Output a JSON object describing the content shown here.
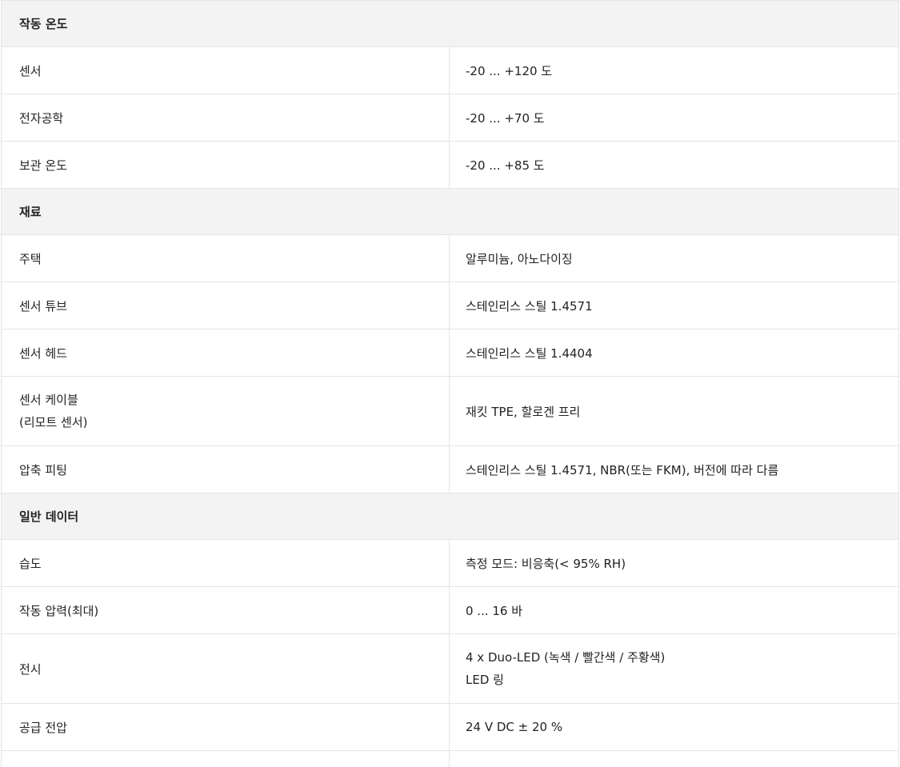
{
  "sections": [
    {
      "title": "작동 온도",
      "rows": [
        {
          "label": [
            "센서"
          ],
          "value": [
            "-20 ... +120 도"
          ]
        },
        {
          "label": [
            "전자공학"
          ],
          "value": [
            "-20 ... +70 도"
          ]
        },
        {
          "label": [
            "보관 온도"
          ],
          "value": [
            "-20 ... +85 도"
          ]
        }
      ]
    },
    {
      "title": "재료",
      "rows": [
        {
          "label": [
            "주택"
          ],
          "value": [
            "알루미늄, 아노다이징"
          ]
        },
        {
          "label": [
            "센서 튜브"
          ],
          "value": [
            "스테인리스 스틸 1.4571"
          ]
        },
        {
          "label": [
            "센서 헤드"
          ],
          "value": [
            "스테인리스 스틸 1.4404"
          ]
        },
        {
          "label": [
            "센서 케이블",
            "(리모트 센서)"
          ],
          "value": [
            "재킷 TPE, 할로겐 프리"
          ]
        },
        {
          "label": [
            "압축 피팅"
          ],
          "value": [
            "스테인리스 스틸 1.4571, NBR(또는 FKM), 버전에 따라 다름"
          ]
        }
      ]
    },
    {
      "title": "일반 데이터",
      "rows": [
        {
          "label": [
            "습도"
          ],
          "value": [
            "측정 모드: 비응축(< 95% RH)"
          ]
        },
        {
          "label": [
            "작동 압력(최대)"
          ],
          "value": [
            "0 ... 16 바"
          ]
        },
        {
          "label": [
            "전시"
          ],
          "value": [
            "4 x Duo-LED (녹색 / 빨간색 / 주황색)",
            "LED 링"
          ]
        },
        {
          "label": [
            "공급 전압"
          ],
          "value": [
            "24 V DC ± 20 %"
          ]
        }
      ]
    }
  ]
}
